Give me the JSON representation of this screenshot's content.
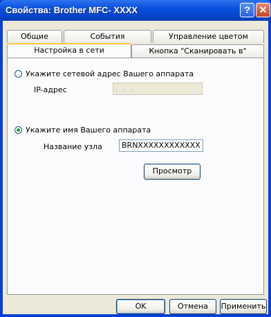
{
  "window": {
    "title": "Свойства: Brother MFC- XXXX",
    "help_button": "?",
    "close_button": "✕"
  },
  "tabs_row1": [
    {
      "label": "Общие"
    },
    {
      "label": "События"
    },
    {
      "label": "Управление цветом"
    }
  ],
  "tabs_row2": [
    {
      "label": "Настройка в сети",
      "active": true
    },
    {
      "label": "Кнопка \"Сканировать в\""
    }
  ],
  "network": {
    "address_option_label": "Укажите сетевой адрес Вашего аппарата",
    "address_option_selected": false,
    "ip_label": "IP-адрес",
    "ip_value": ". . .",
    "name_option_label": "Укажите имя Вашего аппарата",
    "name_option_selected": true,
    "node_name_label": "Название узла",
    "node_name_value": "BRNXXXXXXXXXXXX",
    "browse_button": "Просмотр"
  },
  "footer": {
    "ok_button": "OK",
    "cancel_button": "Отмена",
    "apply_button": "Применить"
  }
}
